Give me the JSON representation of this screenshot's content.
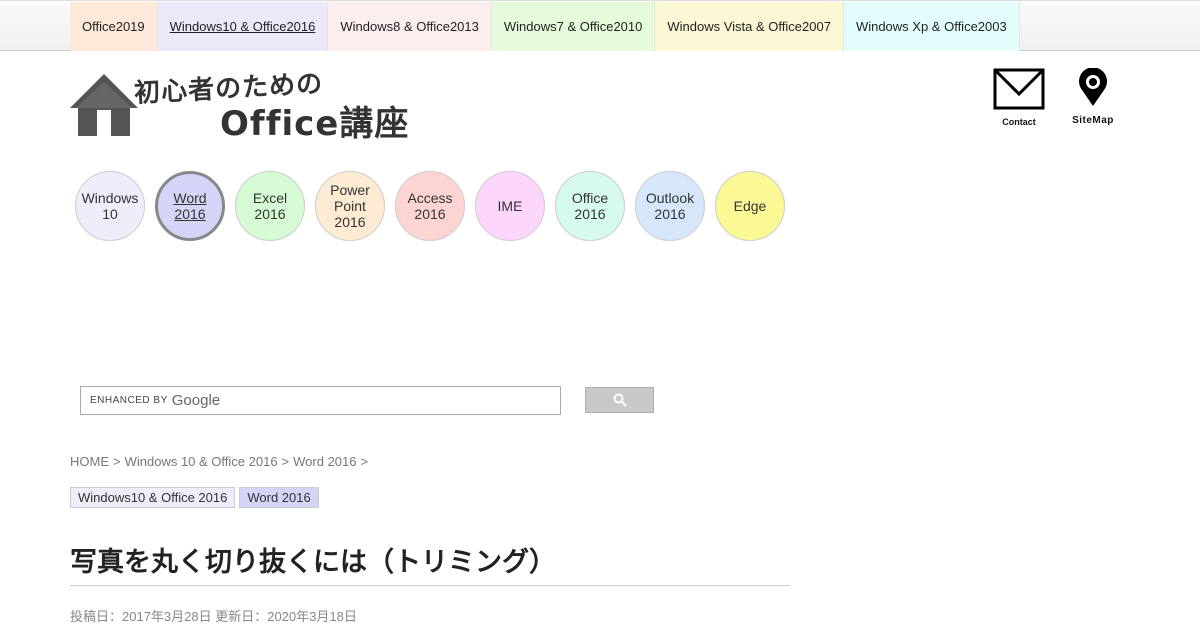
{
  "top_nav": {
    "items": [
      {
        "label": "Office2019",
        "bg": "#fde9d9"
      },
      {
        "label": "Windows10 & Office2016",
        "bg": "#eae9f9"
      },
      {
        "label": "Windows8 & Office2013",
        "bg": "#fdeeee"
      },
      {
        "label": "Windows7 & Office2010",
        "bg": "#e6fbdc"
      },
      {
        "label": "Windows Vista & Office2007",
        "bg": "#fcf8d5"
      },
      {
        "label": "Windows Xp & Office2003",
        "bg": "#e3fdfd"
      }
    ]
  },
  "logo": {
    "line1": "初心者のための",
    "line2": "Office講座"
  },
  "header_links": {
    "contact": "Contact",
    "sitemap": "SiteMap"
  },
  "circle_nav": [
    {
      "label": "Windows\n10",
      "bg": "#eeeefb"
    },
    {
      "label": "Word\n2016",
      "bg": "#d4d4f7"
    },
    {
      "label": "Excel\n2016",
      "bg": "#d6fad4"
    },
    {
      "label": "Power\nPoint\n2016",
      "bg": "#fdebd3"
    },
    {
      "label": "Access\n2016",
      "bg": "#fdd4d4"
    },
    {
      "label": "IME",
      "bg": "#fdd6fb"
    },
    {
      "label": "Office\n2016",
      "bg": "#d6fbec"
    },
    {
      "label": "Outlook\n2016",
      "bg": "#d6e7fb"
    },
    {
      "label": "Edge",
      "bg": "#fbf896"
    }
  ],
  "search": {
    "brand": "ENHANCED BY",
    "google": "Google"
  },
  "breadcrumb": [
    "HOME",
    "Windows 10 & Office 2016",
    "Word 2016"
  ],
  "breadcrumb_sep": ">",
  "tags": [
    {
      "label": "Windows10 & Office 2016",
      "bg": "#eeeefb"
    },
    {
      "label": "Word 2016",
      "bg": "#d4d4f7"
    }
  ],
  "title": "写真を丸く切り抜くには（トリミング）",
  "dates": "投稿日：2017年3月28日 更新日：2020年3月18日"
}
